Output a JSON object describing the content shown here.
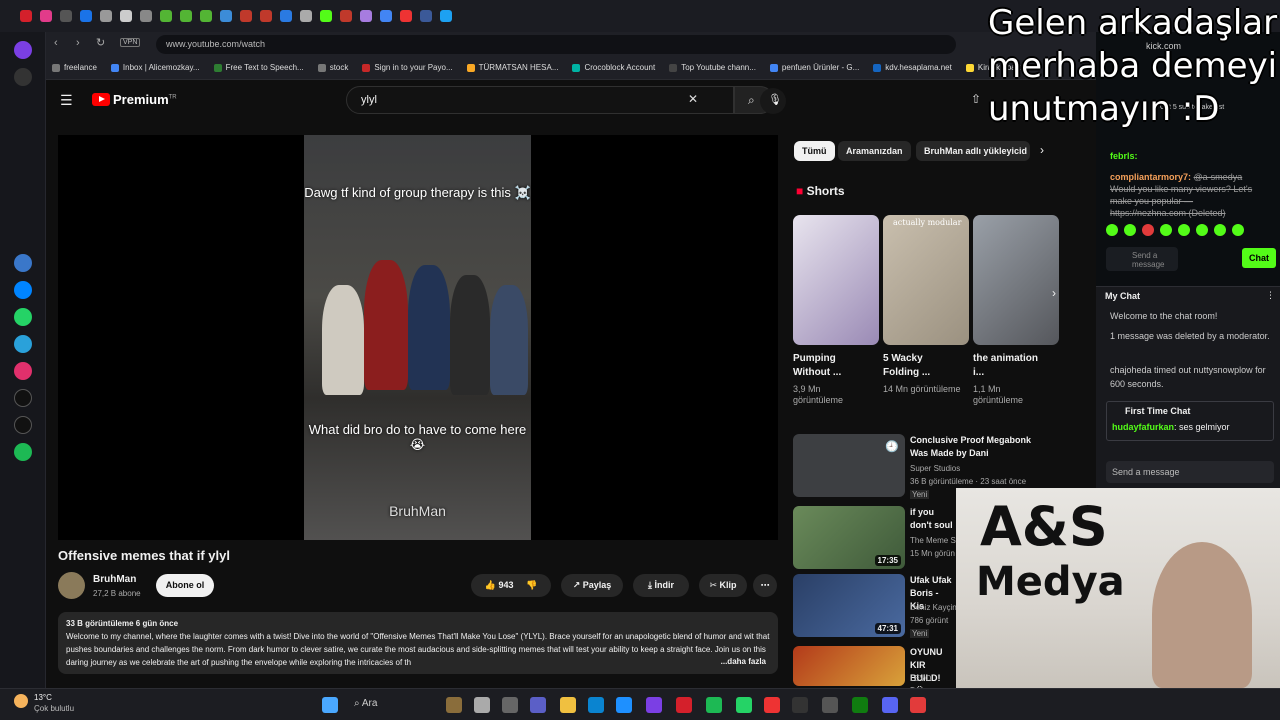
{
  "browser": {
    "url": "www.youtube.com/watch",
    "vpn": "VPN",
    "bookmarks": [
      "freelance",
      "Inbox | Alicemozkay...",
      "Free Text to Speech...",
      "stock",
      "Sign in to your Payo...",
      "TÜRMATSAN HESA...",
      "Crocoblock Account",
      "Top Youtube chann...",
      "penfuen Ürünler - G...",
      "kdv.hesaplama.net",
      "Kiralık apart"
    ]
  },
  "youtube": {
    "logo": "Premium",
    "logo_sup": "TR",
    "search_value": "ylyl",
    "video": {
      "caption_top": "Dawg tf kind of group therapy is this ☠️",
      "caption_bottom": "What did bro do to have to come here 😭",
      "watermark": "BruhMan",
      "title": "Offensive memes that if ylyl",
      "channel": "BruhMan",
      "subscribers": "27,2 B abone",
      "subscribe": "Abone ol",
      "likes": "943",
      "share": "Paylaş",
      "download": "İndir",
      "clip": "Klip",
      "views_time": "33 B görüntüleme  6 gün önce",
      "description": "Welcome to my channel, where the laughter comes with a twist! Dive into the world of \"Offensive Memes That'll Make You Lose\" (YLYL). Brace yourself for an unapologetic blend of humor and wit that pushes boundaries and challenges the norm. From dark humor to clever satire, we curate the most audacious and side-splitting memes that will test your ability to keep a straight face. Join us on this daring journey as we celebrate the art of pushing the envelope while exploring the intricacies of th",
      "more": "...daha fazla"
    },
    "chips": [
      "Tümü",
      "Aramanızdan",
      "BruhMan adlı yükleyicid"
    ],
    "shorts_heading": "Shorts",
    "shorts": [
      {
        "title": "Pumping Without ...",
        "views": "3,9 Mn görüntüleme",
        "color": "#9a8ab5"
      },
      {
        "title": "5 Wacky Folding ...",
        "views": "14 Mn görüntüleme",
        "color": "#9b9180",
        "badge": "actually modular"
      },
      {
        "title": "the animation i...",
        "views": "1,1 Mn görüntüleme",
        "color": "#6e6f74"
      }
    ],
    "related": [
      {
        "title": "Conclusive Proof Megabonk Was Made by Dani",
        "channel": "Super Studios",
        "meta": "36 B görüntüleme · 23 saat önce",
        "badge": "Yeni",
        "duration": ""
      },
      {
        "title": "if you don't soul",
        "channel": "The Meme S",
        "meta": "15 Mn görün",
        "badge": "",
        "duration": "17:35"
      },
      {
        "title": "Ufak Ufak Boris - Kis",
        "channel": "Deniz Kayçin",
        "meta": "786 görünt",
        "badge": "Yeni",
        "duration": "47:31"
      },
      {
        "title": "OYUNU KIR BUILD! DÜ",
        "channel": "LEVO",
        "meta": "",
        "badge": "",
        "duration": ""
      }
    ]
  },
  "chat": {
    "site": "kick.com",
    "gift_text": "Gift 5 sub to take 1st",
    "user1": "febrls:",
    "user2": "compliantarmory7:",
    "msg2": "@a-smedya Would you like many viewers? Let's make you popular — https://nezhna.com (Deleted)",
    "send_placeholder": "Send a message",
    "chat_button": "Chat",
    "my_chat": "My Chat",
    "welcome": "Welcome to the chat room!",
    "deleted_note": "1 message was deleted by a moderator.",
    "timeout_note": "chajoheda timed out nuttysnowplow for 600 seconds.",
    "first_time": "First Time Chat",
    "ft_user": "hudayfafurkan",
    "ft_msg": ": ses gelmiyor",
    "send_message": "Send a message"
  },
  "overlay": {
    "line1": "Gelen arkadaşlar",
    "line2": "merhaba demeyi",
    "line3": "unutmayın :D"
  },
  "logo": {
    "line1": "A&S",
    "line2": "Medya"
  },
  "taskbar": {
    "weather": "13°C",
    "weather_desc": "Çok bulutlu",
    "search": "Ara"
  }
}
